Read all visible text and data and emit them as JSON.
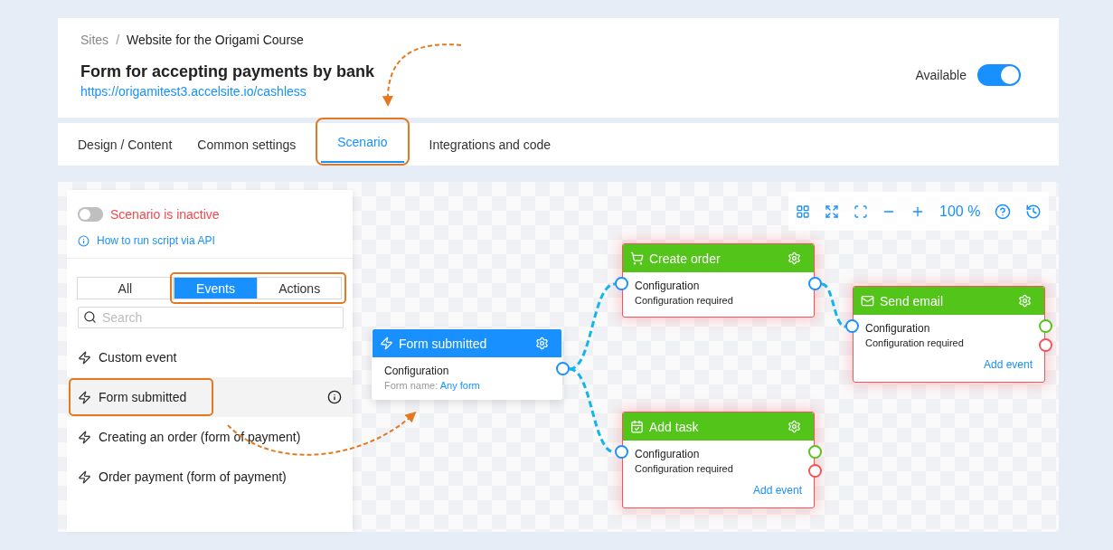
{
  "breadcrumb": [
    {
      "label": "Sites",
      "current": false
    },
    {
      "label": "Website for the Origami Course",
      "current": true
    }
  ],
  "breadcrumb_separator": "/",
  "page": {
    "title": "Form for accepting payments by bank",
    "url": "https://origamitest3.accelsite.io/cashless"
  },
  "availability": {
    "label": "Available",
    "on": true
  },
  "tabs": [
    {
      "label": "Design / Content",
      "selected": false,
      "highlighted": false
    },
    {
      "label": "Common settings",
      "selected": false,
      "highlighted": false
    },
    {
      "label": "Scenario",
      "selected": true,
      "highlighted": true
    },
    {
      "label": "Integrations and code",
      "selected": false,
      "highlighted": false
    }
  ],
  "sidebar": {
    "scenario_toggle": {
      "on": false,
      "label": "Scenario is inactive"
    },
    "help_link": "How to run script via API",
    "filters": [
      {
        "label": "All",
        "selected": false,
        "highlighted": false
      },
      {
        "label": "Events",
        "selected": true,
        "highlighted": true
      },
      {
        "label": "Actions",
        "selected": false,
        "highlighted": true
      }
    ],
    "search": {
      "placeholder": "Search"
    },
    "items": [
      {
        "label": "Custom event",
        "selected": false,
        "highlighted": false
      },
      {
        "label": "Form submitted",
        "selected": true,
        "highlighted": true
      },
      {
        "label": "Creating an order (form of payment)",
        "selected": false,
        "highlighted": false
      },
      {
        "label": "Order payment (form of payment)",
        "selected": false,
        "highlighted": false
      }
    ]
  },
  "toolbar": {
    "zoom": "100 %"
  },
  "nodes": [
    {
      "kind": "event",
      "title": "Form submitted",
      "config_label": "Configuration",
      "detail_label": "Form name:",
      "detail_link": "Any form",
      "error": false,
      "outcome_ports": false
    },
    {
      "kind": "order",
      "title": "Create order",
      "config_label": "Configuration",
      "detail": "Configuration required",
      "error": true,
      "outcome_ports": false
    },
    {
      "kind": "email",
      "title": "Send email",
      "config_label": "Configuration",
      "detail": "Configuration required",
      "add_event": "Add event",
      "error": true,
      "outcome_ports": true
    },
    {
      "kind": "task",
      "title": "Add task",
      "config_label": "Configuration",
      "detail": "Configuration required",
      "add_event": "Add event",
      "error": true,
      "outcome_ports": true
    }
  ]
}
